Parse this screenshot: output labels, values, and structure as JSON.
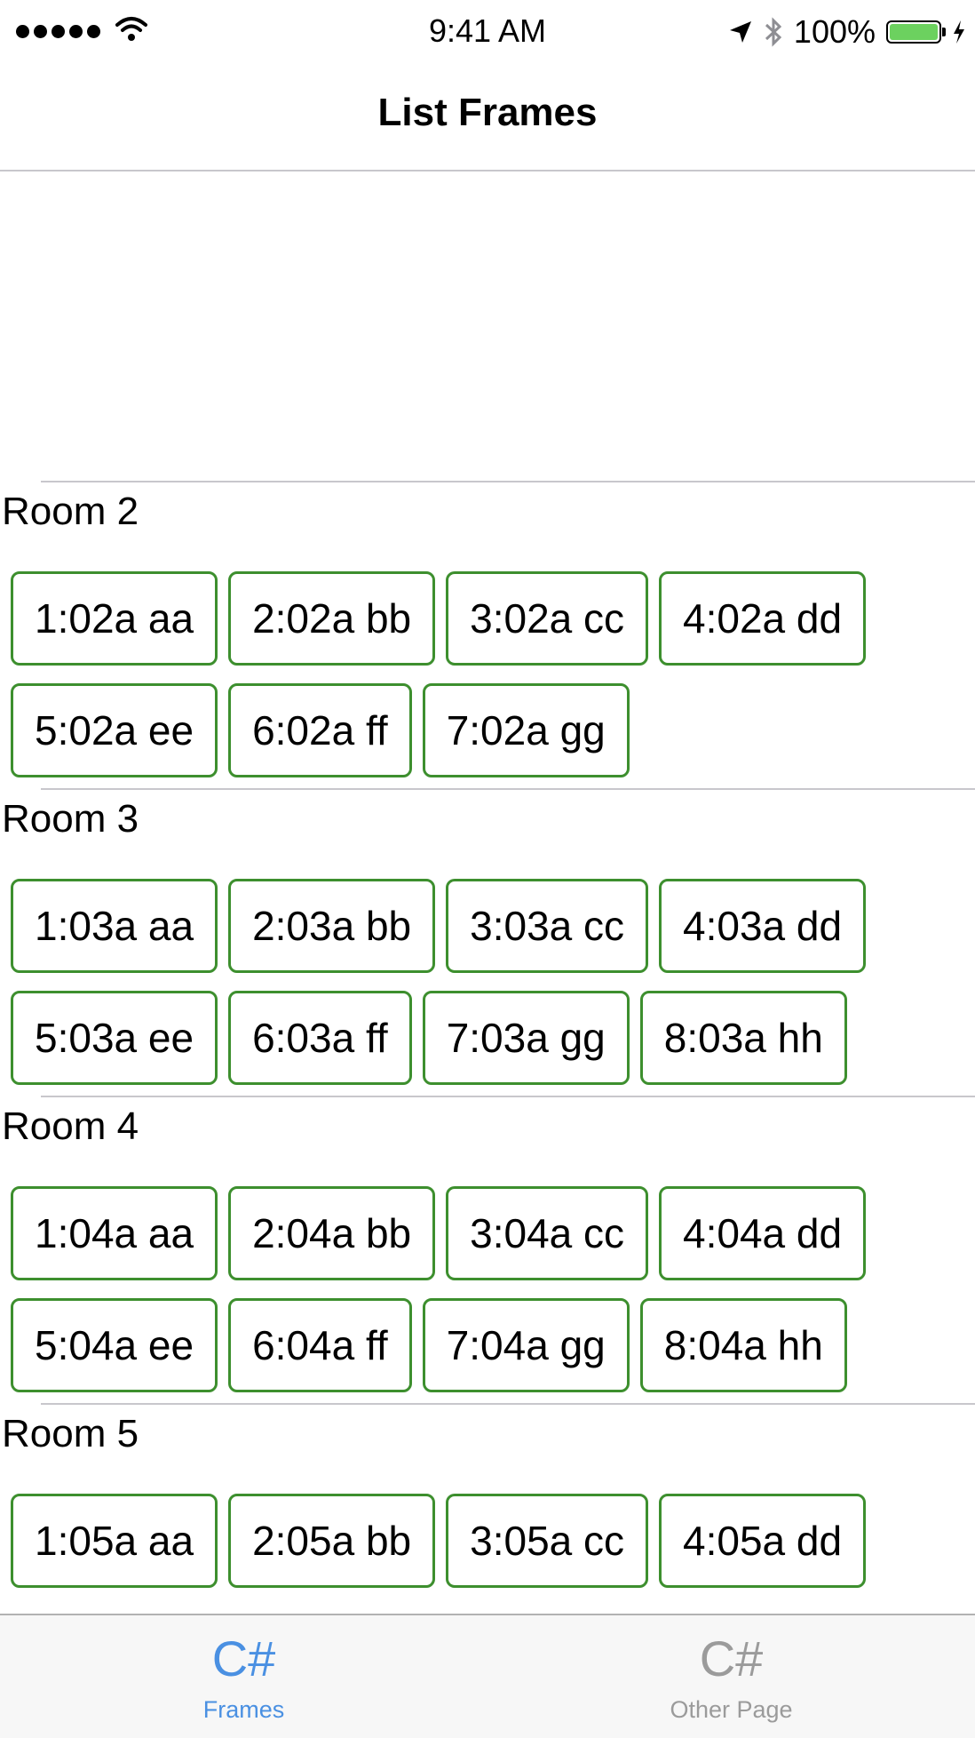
{
  "status_bar": {
    "time": "9:41 AM",
    "battery_percent": "100%",
    "battery_level": 1.0,
    "signal_dots": 5,
    "icons": [
      "signal-dots-icon",
      "wifi-icon",
      "location-arrow-icon",
      "bluetooth-icon",
      "battery-icon",
      "charging-bolt-icon"
    ]
  },
  "nav": {
    "title": "List Frames"
  },
  "rooms": [
    {
      "title": "Room 2",
      "rows": [
        [
          "1:02a aa",
          "2:02a bb",
          "3:02a cc",
          "4:02a dd"
        ],
        [
          "5:02a ee",
          "6:02a ff",
          "7:02a gg"
        ]
      ]
    },
    {
      "title": "Room 3",
      "rows": [
        [
          "1:03a aa",
          "2:03a bb",
          "3:03a cc",
          "4:03a dd"
        ],
        [
          "5:03a ee",
          "6:03a ff",
          "7:03a gg",
          "8:03a hh"
        ]
      ]
    },
    {
      "title": "Room 4",
      "rows": [
        [
          "1:04a aa",
          "2:04a bb",
          "3:04a cc",
          "4:04a dd"
        ],
        [
          "5:04a ee",
          "6:04a ff",
          "7:04a gg",
          "8:04a hh"
        ]
      ]
    },
    {
      "title": "Room 5",
      "rows": [
        [
          "1:05a aa",
          "2:05a bb",
          "3:05a cc",
          "4:05a dd"
        ]
      ]
    }
  ],
  "tabs": [
    {
      "icon_text": "C#",
      "label": "Frames",
      "active": true
    },
    {
      "icon_text": "C#",
      "label": "Other Page",
      "active": false
    }
  ],
  "colors": {
    "button_border": "#3d8f2e",
    "tab_active": "#4a90e2",
    "tab_inactive": "#9b9b9b",
    "battery": "#6cd15f"
  }
}
